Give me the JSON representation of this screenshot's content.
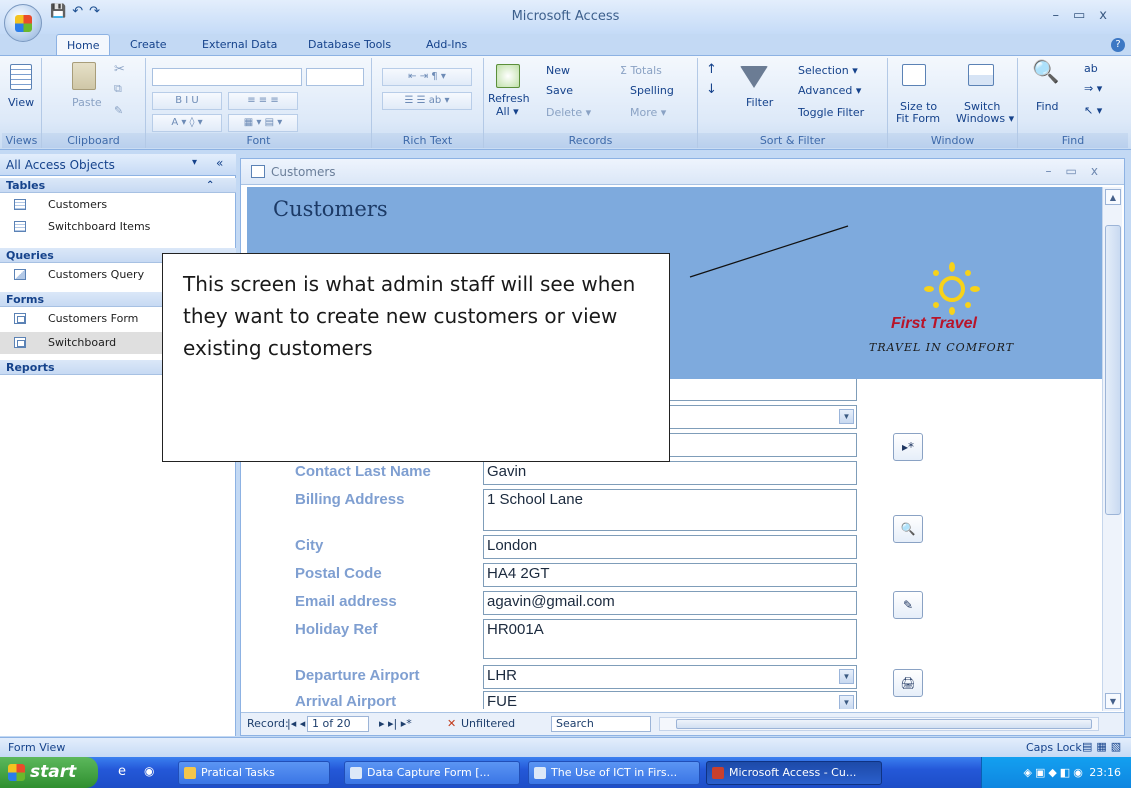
{
  "app": {
    "title": "Microsoft Access"
  },
  "window_controls": {
    "minimize": "–",
    "restore": "▭",
    "close": "x"
  },
  "quick_access": {
    "save": "💾",
    "undo": "↶",
    "redo": "↷"
  },
  "tabs": [
    "Home",
    "Create",
    "External Data",
    "Database Tools",
    "Add-Ins"
  ],
  "ribbon": {
    "groups": [
      "Views",
      "Clipboard",
      "Font",
      "Rich Text",
      "Records",
      "Sort & Filter",
      "Window",
      "Find"
    ],
    "view_label": "View",
    "paste_label": "Paste",
    "refresh_label": "Refresh",
    "refresh_sub": "All ▾",
    "records_items": [
      "New",
      "Save",
      "Delete ▾",
      "Σ Totals",
      "Spelling",
      "More ▾"
    ],
    "filter_label": "Filter",
    "sort_items": [
      "Selection ▾",
      "Advanced ▾",
      "Toggle Filter"
    ],
    "window_items": [
      "Size to",
      "Fit Form",
      "Switch",
      "Windows ▾"
    ],
    "find_label": "Find"
  },
  "nav": {
    "header": "All Access Objects",
    "sections": [
      {
        "title": "Tables",
        "items": [
          "Customers",
          "Switchboard Items"
        ]
      },
      {
        "title": "Queries",
        "items": [
          "Customers Query"
        ]
      },
      {
        "title": "Forms",
        "items": [
          "Customers Form",
          "Switchboard"
        ]
      },
      {
        "title": "Reports",
        "items": []
      }
    ],
    "selected": "Switchboard"
  },
  "doc": {
    "tab_title": "Customers",
    "form_title": "Customers",
    "logo_name": "First Travel",
    "logo_tagline": "TRAVEL IN COMFORT",
    "fields": [
      {
        "label": "Contact Last Name",
        "value": "Gavin"
      },
      {
        "label": "Billing Address",
        "value": "1 School Lane"
      },
      {
        "label": "City",
        "value": "London"
      },
      {
        "label": "Postal Code",
        "value": "HA4 2GT"
      },
      {
        "label": "Email address",
        "value": "agavin@gmail.com"
      },
      {
        "label": "Holiday Ref",
        "value": "HR001A"
      },
      {
        "label": "Departure Airport",
        "value": "LHR"
      },
      {
        "label": "Arrival Airport",
        "value": "FUE"
      }
    ],
    "buttons": {
      "new_record": "▸*",
      "find": "🔍",
      "save": "✎",
      "print": "🖨"
    }
  },
  "record_nav": {
    "label": "Record:",
    "position": "1 of 20",
    "filter": "Unfiltered",
    "search": "Search"
  },
  "callout": {
    "text": "This screen is what admin staff will see when they want to create new customers or view existing customers"
  },
  "status": {
    "left": "Form View",
    "right": "Caps Lock"
  },
  "taskbar": {
    "start": "start",
    "items": [
      "Pratical Tasks",
      "Data Capture Form [...",
      "The Use of ICT in Firs...",
      "Microsoft Access - Cu..."
    ],
    "active": "Microsoft Access - Cu...",
    "clock": "23:16"
  }
}
